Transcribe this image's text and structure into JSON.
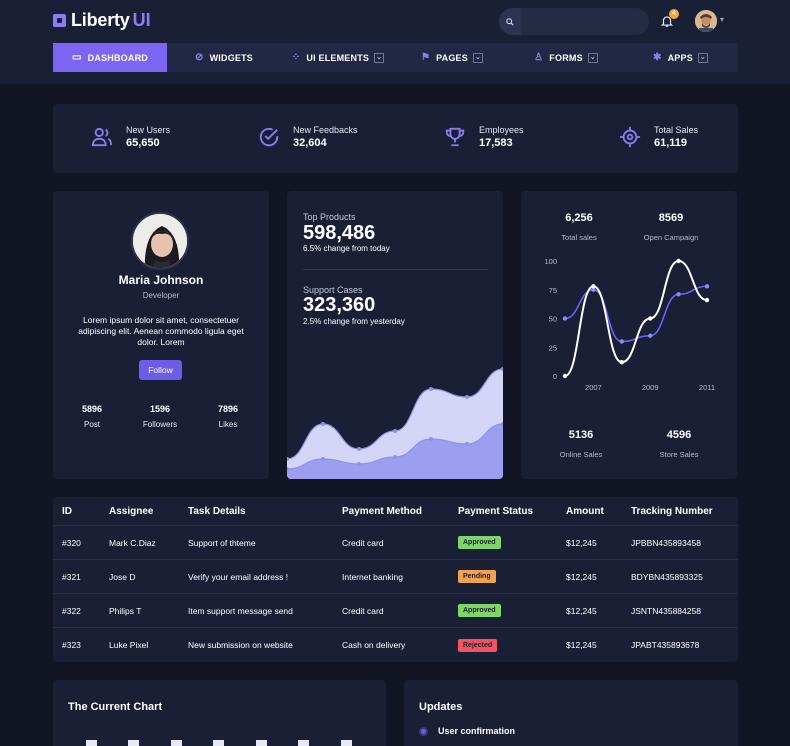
{
  "header": {
    "logo_main": "Liberty",
    "logo_accent": "UI",
    "search_placeholder": "",
    "notification_count": "4"
  },
  "nav": [
    {
      "label": "DASHBOARD",
      "icon": "monitor-icon",
      "active": true,
      "dropdown": false
    },
    {
      "label": "WIDGETS",
      "icon": "compass-icon",
      "active": false,
      "dropdown": false
    },
    {
      "label": "UI ELEMENTS",
      "icon": "grid-icon",
      "active": false,
      "dropdown": true
    },
    {
      "label": "PAGES",
      "icon": "flag-icon",
      "active": false,
      "dropdown": true
    },
    {
      "label": "FORMS",
      "icon": "user-icon",
      "active": false,
      "dropdown": true
    },
    {
      "label": "APPS",
      "icon": "asterisk-icon",
      "active": false,
      "dropdown": true
    }
  ],
  "stats": [
    {
      "label": "New Users",
      "value": "65,650",
      "icon": "users-icon"
    },
    {
      "label": "New Feedbacks",
      "value": "32,604",
      "icon": "check-circle-icon"
    },
    {
      "label": "Employees",
      "value": "17,583",
      "icon": "trophy-icon"
    },
    {
      "label": "Total Sales",
      "value": "61,119",
      "icon": "crosshair-icon"
    }
  ],
  "profile": {
    "name": "Maria Johnson",
    "role": "Developer",
    "bio": "Lorem ipsum dolor sit amet, consectetuer adipiscing elit. Aenean commodo ligula eget dolor. Lorem",
    "follow_label": "Follow",
    "post_count": "5896",
    "post_label": "Post",
    "followers_count": "1596",
    "followers_label": "Followers",
    "likes_count": "7896",
    "likes_label": "Likes"
  },
  "products": {
    "top_title": "Top Products",
    "top_value": "598,486",
    "top_change": "6.5% change from today",
    "support_title": "Support Cases",
    "support_value": "323,360",
    "support_change": "2.5% change from yesterday"
  },
  "sales_card": {
    "total_sales_value": "6,256",
    "total_sales_label": "Total sales",
    "open_campaign_value": "8569",
    "open_campaign_label": "Open Campaign",
    "online_sales_value": "5136",
    "online_sales_label": "Online Sales",
    "store_sales_value": "4596",
    "store_sales_label": "Store Sales"
  },
  "chart_data": [
    {
      "type": "area",
      "series": [
        {
          "values": [
            20,
            55,
            30,
            48,
            90,
            82,
            110
          ]
        },
        {
          "values": [
            10,
            20,
            15,
            22,
            40,
            35,
            55
          ]
        }
      ],
      "colors": [
        "#d4d6f8",
        "#9c9ef0"
      ]
    },
    {
      "type": "line",
      "x": [
        2006,
        2007,
        2008,
        2009,
        2010,
        2011
      ],
      "xticks": [
        "2007",
        "2009",
        "2011"
      ],
      "yticks": [
        "0",
        "25",
        "50",
        "75",
        "100"
      ],
      "ylim": [
        0,
        100
      ],
      "series": [
        {
          "color": "#ffffff",
          "values": [
            0,
            78,
            12,
            50,
            100,
            66
          ]
        },
        {
          "color": "#6c63ff",
          "values": [
            50,
            75,
            30,
            35,
            71,
            78
          ]
        }
      ]
    }
  ],
  "table": {
    "headers": [
      "ID",
      "Assignee",
      "Task Details",
      "Payment Method",
      "Payment Status",
      "Amount",
      "Tracking Number"
    ],
    "rows": [
      {
        "id": "#320",
        "assignee": "Mark C.Diaz",
        "task": "Support of thteme",
        "method": "Credit card",
        "status": "Approved",
        "status_color": "#7ed66b",
        "amount": "$12,245",
        "tracking": "JPBBN435893458"
      },
      {
        "id": "#321",
        "assignee": "Jose D",
        "task": "Verify your email address !",
        "method": "Internet banking",
        "status": "Pending",
        "status_color": "#f0a24e",
        "amount": "$12,245",
        "tracking": "BDYBN435893325"
      },
      {
        "id": "#322",
        "assignee": "Philips T",
        "task": "Item support message send",
        "method": "Credit card",
        "status": "Approved",
        "status_color": "#7ed66b",
        "amount": "$12,245",
        "tracking": "JSNTN435884258"
      },
      {
        "id": "#323",
        "assignee": "Luke Pixel",
        "task": "New submission on website",
        "method": "Cash on delivery",
        "status": "Rejected",
        "status_color": "#f0555f",
        "amount": "$12,245",
        "tracking": "JPABT435893678"
      }
    ]
  },
  "current_chart": {
    "title": "The Current Chart"
  },
  "updates": {
    "title": "Updates",
    "first_item": "User confirmation"
  },
  "colors": {
    "accent": "#7a66f2",
    "background": "#111524",
    "card": "#192036"
  }
}
